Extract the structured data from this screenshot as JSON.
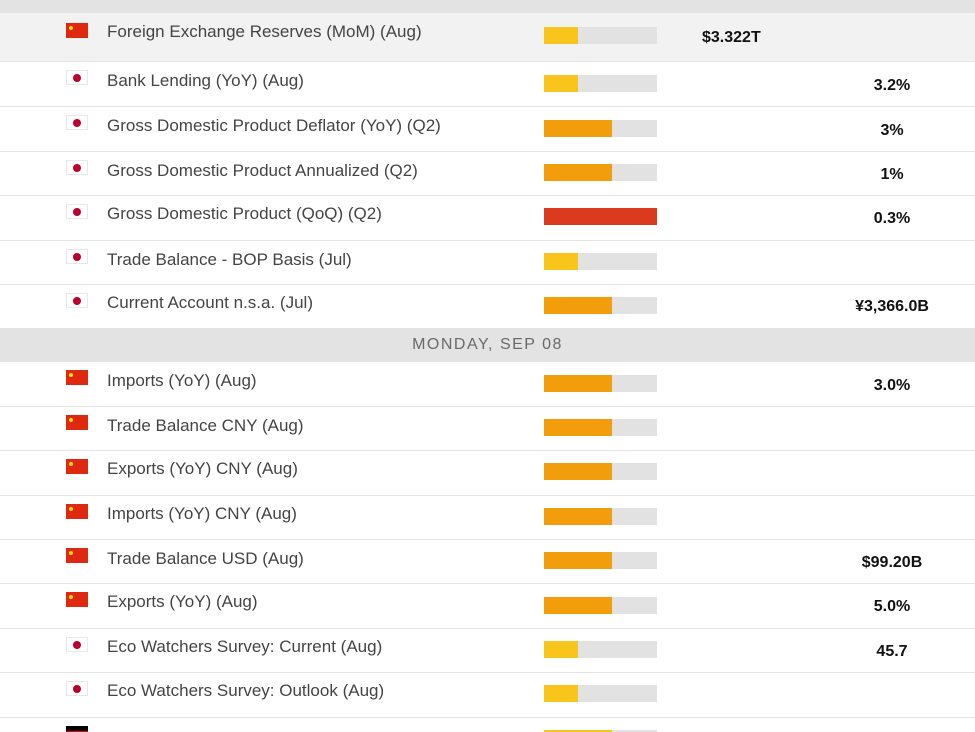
{
  "calendar": {
    "date_headers": {
      "monday": "MONDAY, SEP 08"
    },
    "rows": [
      {
        "flag": "china-flag-icon",
        "event": "Foreign Exchange Reserves (MoM) (Aug)",
        "impact": "low",
        "impact_level": 0.3,
        "value_a": "$3.322T",
        "value_b": ""
      },
      {
        "flag": "japan-flag-icon",
        "event": "Bank Lending (YoY) (Aug)",
        "impact": "low",
        "impact_level": 0.3,
        "value_a": "",
        "value_b": "3.2%"
      },
      {
        "flag": "japan-flag-icon",
        "event": "Gross Domestic Product Deflator (YoY) (Q2)",
        "impact": "medium",
        "impact_level": 0.6,
        "value_a": "",
        "value_b": "3%"
      },
      {
        "flag": "japan-flag-icon",
        "event": "Gross Domestic Product Annualized (Q2)",
        "impact": "medium",
        "impact_level": 0.6,
        "value_a": "",
        "value_b": "1%"
      },
      {
        "flag": "japan-flag-icon",
        "event": "Gross Domestic Product (QoQ) (Q2)",
        "impact": "high",
        "impact_level": 1.0,
        "value_a": "",
        "value_b": "0.3%"
      },
      {
        "flag": "japan-flag-icon",
        "event": "Trade Balance - BOP Basis (Jul)",
        "impact": "low",
        "impact_level": 0.3,
        "value_a": "",
        "value_b": ""
      },
      {
        "flag": "japan-flag-icon",
        "event": "Current Account n.s.a. (Jul)",
        "impact": "medium",
        "impact_level": 0.6,
        "value_a": "",
        "value_b": "¥3,366.0B"
      },
      {
        "flag": "china-flag-icon",
        "event": "Imports (YoY) (Aug)",
        "impact": "medium",
        "impact_level": 0.6,
        "value_a": "",
        "value_b": "3.0%"
      },
      {
        "flag": "china-flag-icon",
        "event": "Trade Balance CNY (Aug)",
        "impact": "medium",
        "impact_level": 0.6,
        "value_a": "",
        "value_b": ""
      },
      {
        "flag": "china-flag-icon",
        "event": "Exports (YoY) CNY (Aug)",
        "impact": "medium",
        "impact_level": 0.6,
        "value_a": "",
        "value_b": ""
      },
      {
        "flag": "china-flag-icon",
        "event": "Imports (YoY) CNY (Aug)",
        "impact": "medium",
        "impact_level": 0.6,
        "value_a": "",
        "value_b": ""
      },
      {
        "flag": "china-flag-icon",
        "event": "Trade Balance USD (Aug)",
        "impact": "medium",
        "impact_level": 0.6,
        "value_a": "",
        "value_b": "$99.20B"
      },
      {
        "flag": "china-flag-icon",
        "event": "Exports (YoY) (Aug)",
        "impact": "medium",
        "impact_level": 0.6,
        "value_a": "",
        "value_b": "5.0%"
      },
      {
        "flag": "japan-flag-icon",
        "event": "Eco Watchers Survey: Current (Aug)",
        "impact": "low",
        "impact_level": 0.3,
        "value_a": "",
        "value_b": "45.7"
      },
      {
        "flag": "japan-flag-icon",
        "event": "Eco Watchers Survey: Outlook (Aug)",
        "impact": "low",
        "impact_level": 0.3,
        "value_a": "",
        "value_b": ""
      },
      {
        "flag": "germany-flag-icon",
        "event": "",
        "impact": "low",
        "impact_level": 0.6,
        "value_a": "",
        "value_b": ""
      }
    ]
  },
  "colors": {
    "impact_low": "#f7c51b",
    "impact_medium": "#f29e0c",
    "impact_high": "#dc3a1e",
    "header_bg": "#e3e3e3"
  }
}
